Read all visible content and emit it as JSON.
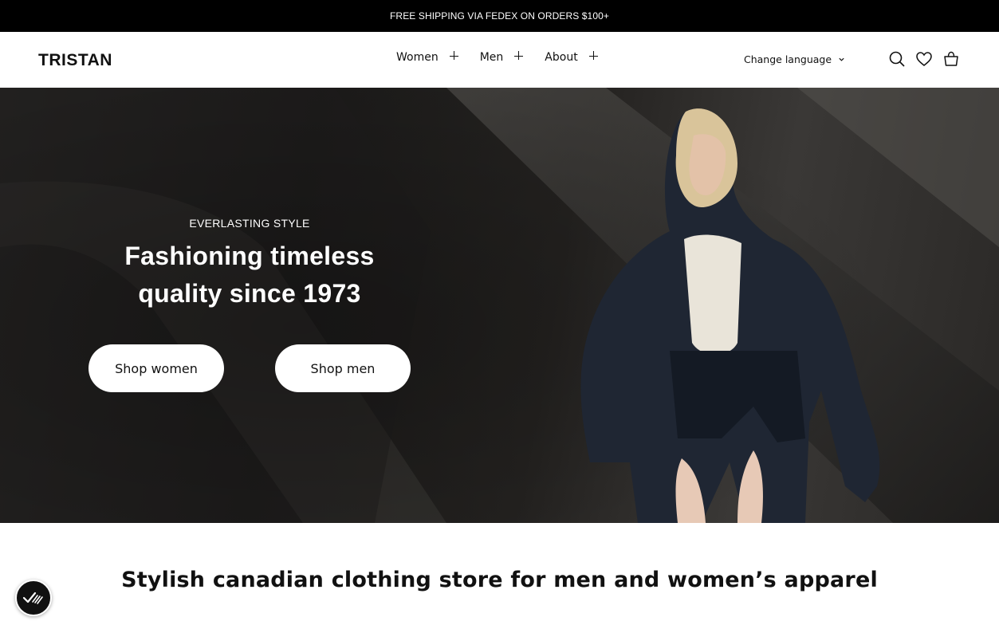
{
  "announcement": {
    "text": "FREE SHIPPING VIA FEDEX ON ORDERS $100+"
  },
  "header": {
    "logo": "TRISTAN",
    "nav": [
      {
        "label": "Women"
      },
      {
        "label": "Men"
      },
      {
        "label": "About"
      }
    ],
    "language": "Change language",
    "icons": [
      "search-icon",
      "heart-icon",
      "shopping-bag-icon"
    ]
  },
  "hero": {
    "eyebrow": "EVERLASTING STYLE",
    "headline_line1": "Fashioning timeless",
    "headline_line2": "quality since 1973",
    "button_women": "Shop women",
    "button_men": "Shop men"
  },
  "section": {
    "title": "Stylish canadian clothing store for men and women’s apparel"
  },
  "accessibility_badge": {
    "icon": "accessibility-check-icon"
  },
  "colors": {
    "announcement_bg": "#000000",
    "hero_bg": "#1f1e1d",
    "button_bg": "#ffffff"
  }
}
